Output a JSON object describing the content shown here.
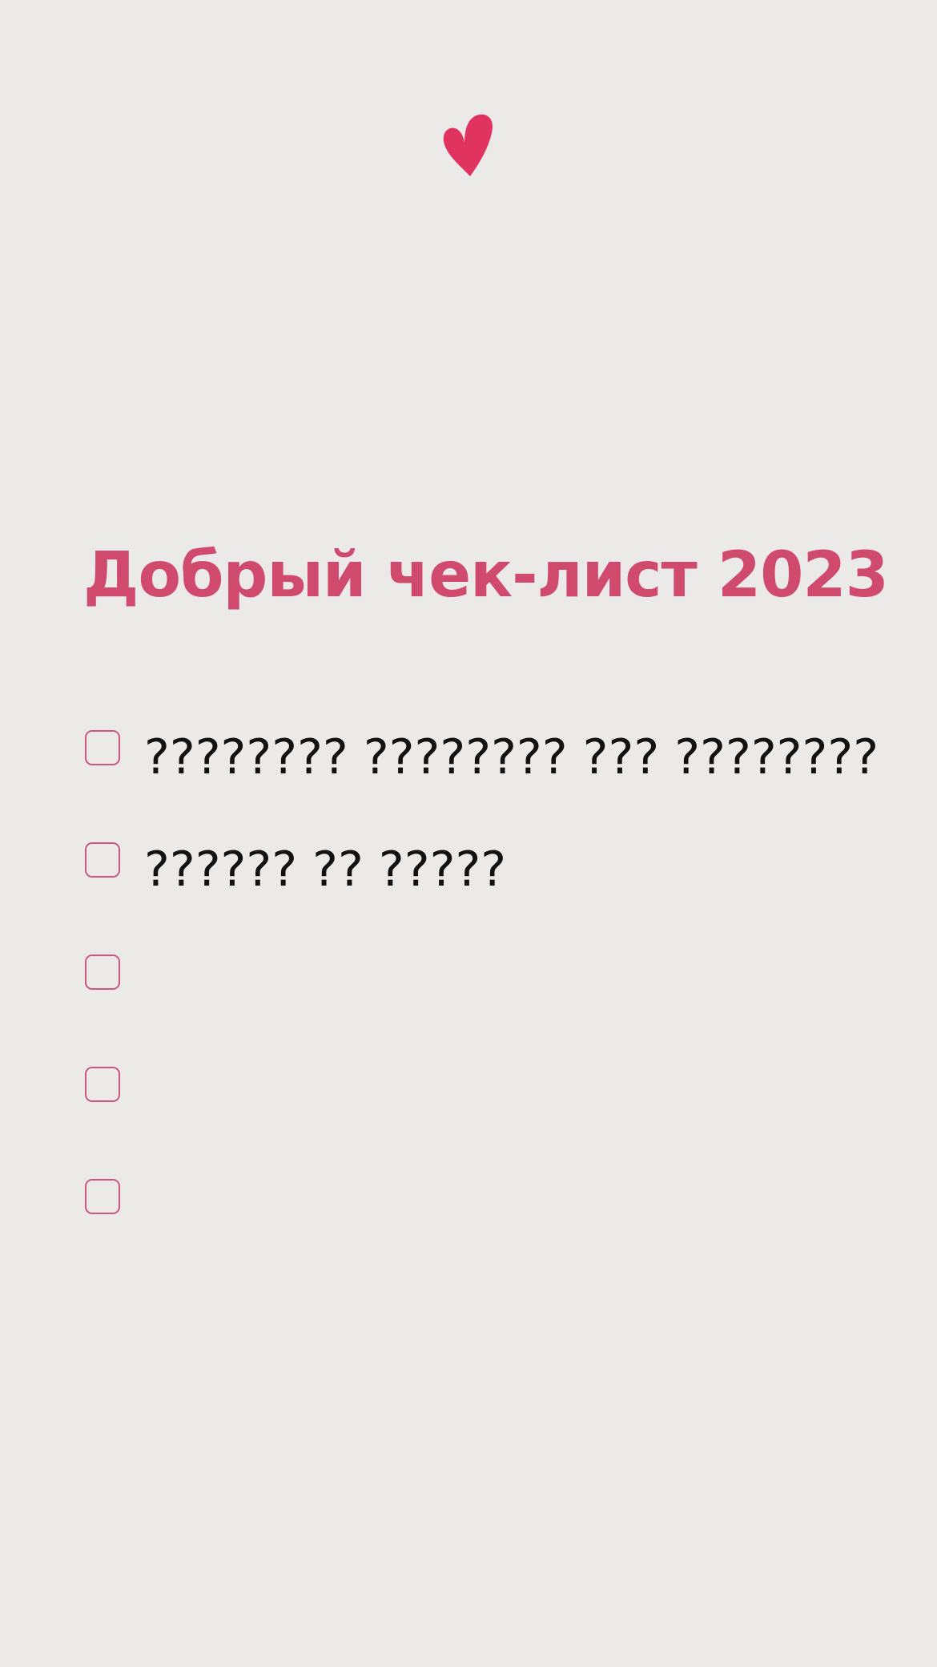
{
  "header": {
    "icon": "heart-icon",
    "accent_color": "#e0335f"
  },
  "title": "Добрый чек-лист 2023",
  "title_color": "#d04a6e",
  "checklist": {
    "items": [
      {
        "text": "???????? ???????? ??? ????????",
        "checked": false
      },
      {
        "text": "?????? ?? ?????",
        "checked": false
      },
      {
        "text": "",
        "checked": false
      },
      {
        "text": "",
        "checked": false
      },
      {
        "text": "",
        "checked": false
      }
    ]
  }
}
